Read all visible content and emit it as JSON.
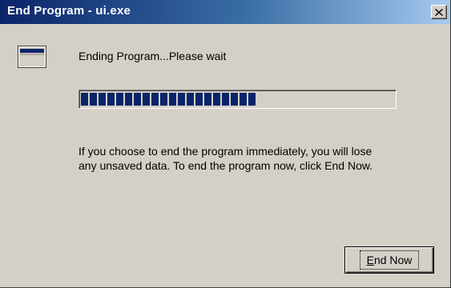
{
  "window": {
    "title": "End Program - ui.exe",
    "icon": "window-icon"
  },
  "titlebar": {
    "close_icon": "close-icon",
    "close_glyph": "×"
  },
  "content": {
    "status": "Ending Program...Please wait",
    "progress": 0.55,
    "warning_lines": [
      "If you choose to end the program immediately, you will lose",
      "any unsaved data. To end the program now, click End Now."
    ]
  },
  "buttons": {
    "end_now": {
      "mnemonic": "E",
      "rest": "nd Now"
    }
  },
  "colors": {
    "title_gradient_start": "#0a246a",
    "title_gradient_end": "#a6caf0",
    "face": "#d4d0c8",
    "progress_block": "#0a246a"
  }
}
